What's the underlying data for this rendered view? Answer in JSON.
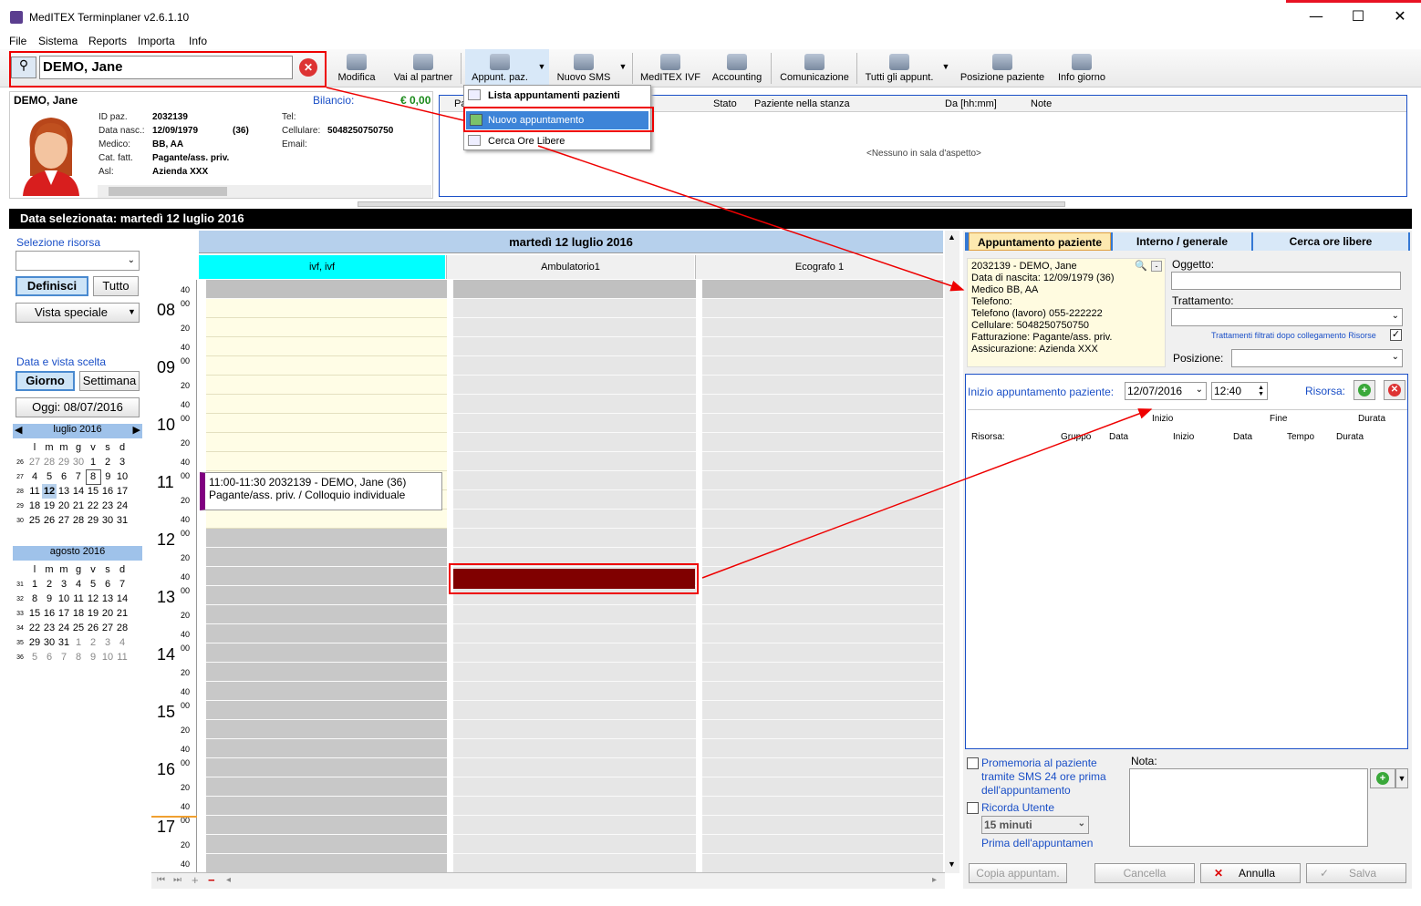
{
  "window": {
    "title": "MedITEX Terminplaner  v2.6.1.10",
    "minimize": "—",
    "maximize": "☐",
    "close": "✕"
  },
  "menu": [
    "File",
    "Sistema",
    "Reports",
    "Importa",
    "Info"
  ],
  "search": {
    "value": "DEMO, Jane"
  },
  "toolbar": [
    {
      "label": "Modifica",
      "icon": "edit-icon"
    },
    {
      "label": "Vai al partner",
      "icon": "partner-icon"
    },
    {
      "label": "Appunt. paz.",
      "icon": "appointment-icon"
    },
    {
      "label": "Nuovo SMS",
      "icon": "sms-icon"
    },
    {
      "label": "MedITEX IVF",
      "icon": "ivf-icon"
    },
    {
      "label": "Accounting",
      "icon": "accounting-icon"
    },
    {
      "label": "Comunicazione",
      "icon": "communication-icon"
    },
    {
      "label": "Tutti gli appunt.",
      "icon": "all-appointments-icon"
    },
    {
      "label": "Posizione paziente",
      "icon": "position-icon"
    },
    {
      "label": "Info giorno",
      "icon": "info-day-icon"
    }
  ],
  "dropdown_menu": [
    "Lista appuntamenti pazienti",
    "Nuovo appuntamento",
    "Cerca Ore Libere"
  ],
  "patient": {
    "name": "DEMO, Jane",
    "balance_label": "Bilancio:",
    "balance": "€ 0,00",
    "id_label": "ID paz.",
    "id": "2032139",
    "dob_label": "Data nasc.:",
    "dob": "12/09/1979",
    "age": "(36)",
    "doctor_label": "Medico:",
    "doctor": "BB, AA",
    "cat_label": "Cat. fatt.",
    "cat": "Pagante/ass. priv.",
    "asl_label": "Asl:",
    "asl": "Azienda XXX",
    "tel_label": "Tel:",
    "cell_label": "Cellulare:",
    "cell": "5048250750750",
    "email_label": "Email:"
  },
  "waiting": {
    "columns": [
      "Pa",
      "Stato",
      "Paziente nella stanza",
      "Da [hh:mm]",
      "Note"
    ],
    "empty": "<Nessuno in sala d'aspetto>"
  },
  "selected_date": "Data selezionata:  martedì 12 luglio 2016",
  "left": {
    "resource_label": "Selezione risorsa",
    "define": "Definisci",
    "all": "Tutto",
    "special_view": "Vista speciale",
    "date_view_label": "Data e vista scelta",
    "day": "Giorno",
    "week": "Settimana",
    "today": "Oggi: 08/07/2016"
  },
  "calendar_july": {
    "title": "luglio 2016",
    "days": [
      "l",
      "m",
      "m",
      "g",
      "v",
      "s",
      "d"
    ],
    "weeks": [
      [
        "26",
        "27",
        "28",
        "29",
        "30",
        "1",
        "2",
        "3"
      ],
      [
        "27",
        "4",
        "5",
        "6",
        "7",
        "8",
        "9",
        "10"
      ],
      [
        "28",
        "11",
        "12",
        "13",
        "14",
        "15",
        "16",
        "17"
      ],
      [
        "29",
        "18",
        "19",
        "20",
        "21",
        "22",
        "23",
        "24"
      ],
      [
        "30",
        "25",
        "26",
        "27",
        "28",
        "29",
        "30",
        "31"
      ]
    ]
  },
  "calendar_august": {
    "title": "agosto 2016",
    "days": [
      "l",
      "m",
      "m",
      "g",
      "v",
      "s",
      "d"
    ],
    "weeks": [
      [
        "31",
        "1",
        "2",
        "3",
        "4",
        "5",
        "6",
        "7"
      ],
      [
        "32",
        "8",
        "9",
        "10",
        "11",
        "12",
        "13",
        "14"
      ],
      [
        "33",
        "15",
        "16",
        "17",
        "18",
        "19",
        "20",
        "21"
      ],
      [
        "34",
        "22",
        "23",
        "24",
        "25",
        "26",
        "27",
        "28"
      ],
      [
        "35",
        "29",
        "30",
        "31",
        "1",
        "2",
        "3",
        "4"
      ],
      [
        "36",
        "5",
        "6",
        "7",
        "8",
        "9",
        "10",
        "11"
      ]
    ]
  },
  "schedule": {
    "day_title": "martedì 12 luglio 2016",
    "resources": [
      "ivf, ivf",
      "Ambulatorio1",
      "Ecografo 1"
    ],
    "hours": [
      "08",
      "09",
      "10",
      "11",
      "12",
      "13",
      "14",
      "15",
      "16",
      "17"
    ],
    "minute_labels": [
      "00",
      "20",
      "40"
    ],
    "appointment": {
      "line1": "11:00-11:30 2032139 - DEMO, Jane (36)",
      "line2": "Pagante/ass. priv. / Colloquio individuale"
    }
  },
  "right": {
    "tabs": [
      "Appuntamento paziente",
      "Interno / generale",
      "Cerca ore libere"
    ],
    "info_lines": [
      "2032139 - DEMO, Jane",
      "Data di nascita: 12/09/1979 (36)",
      "Medico BB, AA",
      "Telefono:",
      "Telefono (lavoro) 055-222222",
      "Cellulare: 5048250750750",
      "Fatturazione: Pagante/ass. priv.",
      "Assicurazione: Azienda XXX"
    ],
    "object_label": "Oggetto:",
    "treatment_label": "Trattamento:",
    "filter_label": "Trattamenti filtrati dopo collegamento Risorse",
    "position_label": "Posizione:",
    "start_label": "Inizio appuntamento paziente:",
    "start_date": "12/07/2016",
    "start_time": "12:40",
    "resource_label": "Risorsa:",
    "table_hdr1": [
      "Inizio",
      "Fine",
      "Durata"
    ],
    "table_hdr2": [
      "Risorsa:",
      "Gruppo",
      "Data",
      "Inizio",
      "Data",
      "Tempo",
      "Durata"
    ],
    "sms_reminder": "Promemoria al paziente tramite SMS 24 ore prima dell'appuntamento",
    "user_reminder": "Ricorda Utente",
    "reminder_time": "15 minuti",
    "before_label": "Prima dell'appuntamen",
    "note_label": "Nota:",
    "buttons": [
      "Copia appuntam.",
      "Cancella",
      "Annulla",
      "Salva"
    ]
  }
}
